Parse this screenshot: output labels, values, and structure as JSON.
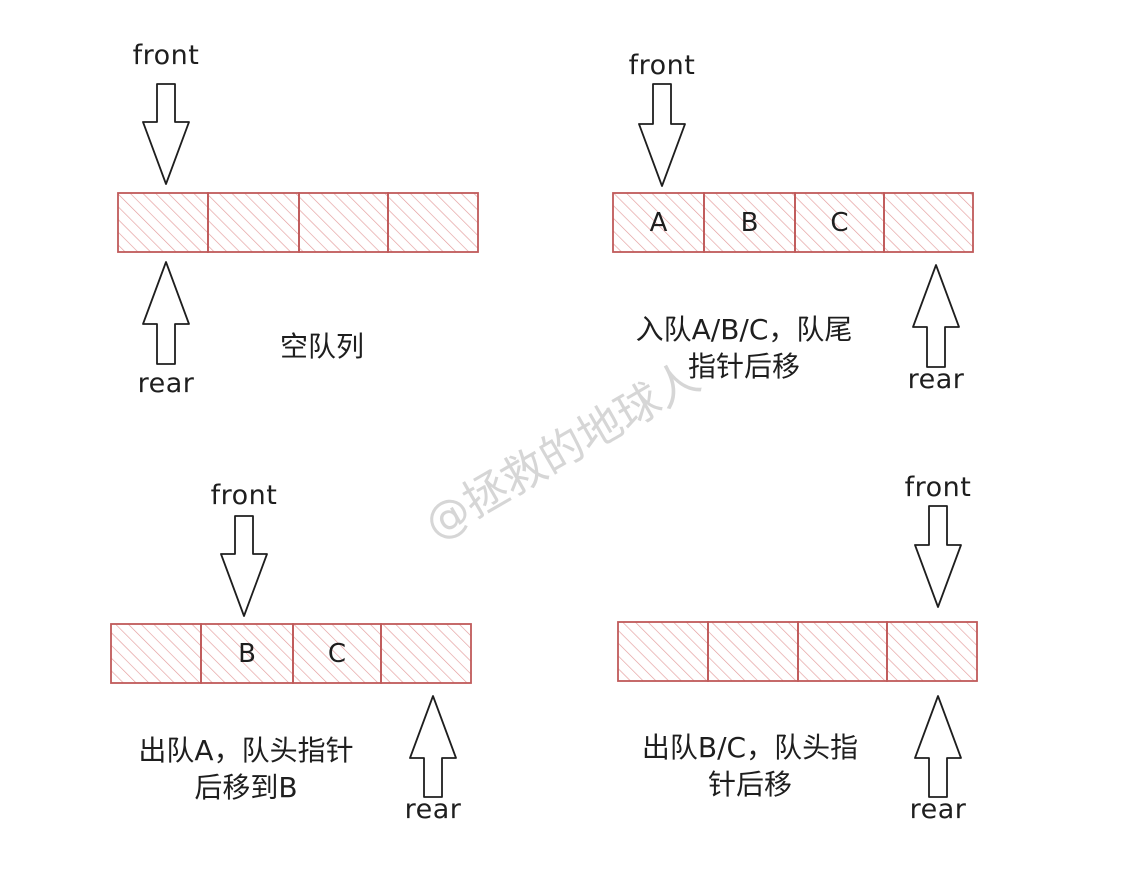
{
  "colors": {
    "cell_stroke": "#c05a5a",
    "hatch": "#e39b9b",
    "arrow": "#1e1e1e",
    "text": "#1e1e1e",
    "watermark": "#cfcfcf"
  },
  "icons": {
    "pointer_down": "down-arrow-icon",
    "pointer_up": "up-arrow-icon"
  },
  "watermark": "@拯救的地球人",
  "panels": [
    {
      "id": "empty",
      "caption": [
        "空队列"
      ],
      "front_label": "front",
      "rear_label": "rear",
      "cells": [
        "",
        "",
        "",
        ""
      ]
    },
    {
      "id": "enqueue",
      "caption": [
        "入队A/B/C，队尾",
        "指针后移"
      ],
      "front_label": "front",
      "rear_label": "rear",
      "cells": [
        "A",
        "B",
        "C",
        ""
      ]
    },
    {
      "id": "dequeue-a",
      "caption": [
        "出队A，队头指针",
        "后移到B"
      ],
      "front_label": "front",
      "rear_label": "rear",
      "cells": [
        "",
        "B",
        "C",
        ""
      ]
    },
    {
      "id": "dequeue-bc",
      "caption": [
        "出队B/C，队头指",
        "针后移"
      ],
      "front_label": "front",
      "rear_label": "rear",
      "cells": [
        "",
        "",
        "",
        ""
      ]
    }
  ]
}
